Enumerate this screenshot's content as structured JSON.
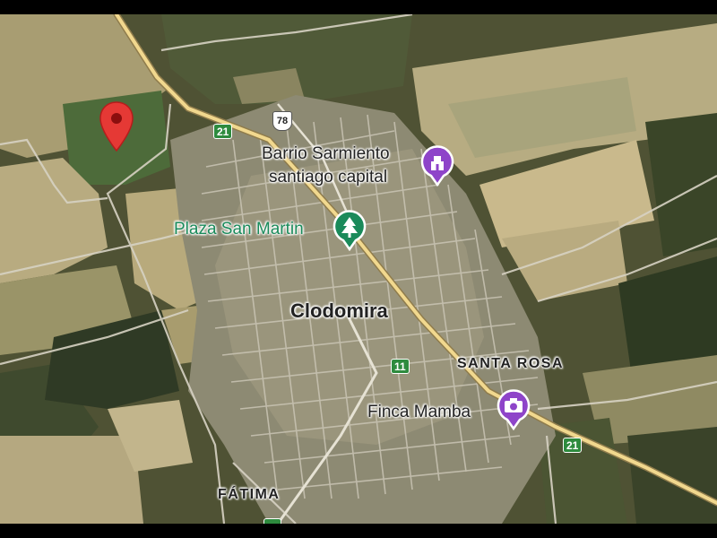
{
  "map": {
    "places": {
      "barrio_line1": "Barrio Sarmiento",
      "barrio_line2": "santiago capital",
      "plaza": "Plaza San Martin",
      "town": "Clodomira",
      "santa_rosa": "SANTA ROSA",
      "finca": "Finca Mamba",
      "fatima": "FÁTIMA"
    },
    "route_shields": {
      "route_21_north": "21",
      "route_78": "78",
      "route_11": "11",
      "route_21_east": "21"
    },
    "markers": {
      "selected_pin": "red-location-pin",
      "barrio_icon": "monument-icon",
      "plaza_icon": "park-tree-icon",
      "finca_icon": "camera-attraction-icon"
    },
    "colors": {
      "pin_red": "#e53935",
      "poi_purple": "#8e44c9",
      "park_green": "#1a8a5a",
      "route_green": "#2e8b3e",
      "main_road": "#e8cf8a"
    }
  }
}
